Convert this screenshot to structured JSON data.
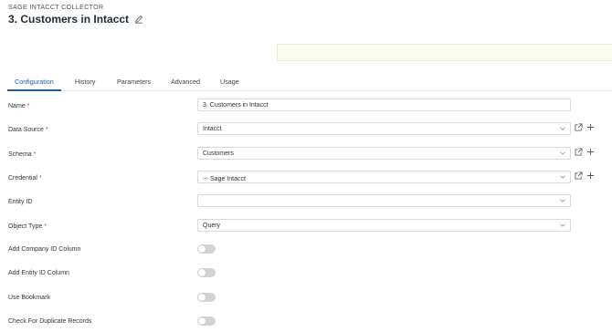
{
  "header": {
    "eyebrow": "SAGE INTACCT COLLECTOR",
    "title": "3. Customers in Intacct"
  },
  "tabs": [
    {
      "label": "Configuration",
      "active": true
    },
    {
      "label": "History",
      "active": false
    },
    {
      "label": "Parameters",
      "active": false
    },
    {
      "label": "Advanced",
      "active": false
    },
    {
      "label": "Usage",
      "active": false
    }
  ],
  "form": {
    "name": {
      "label": "Name",
      "required": true,
      "value": "3. Customers in Intacct"
    },
    "data_source": {
      "label": "Data Source",
      "required": true,
      "value": "Intacct"
    },
    "schema": {
      "label": "Schema",
      "required": true,
      "value": "Customers"
    },
    "credential": {
      "label": "Credential",
      "required": true,
      "icon": "sage-logo-icon",
      "value": "Sage Intacct"
    },
    "entity_id": {
      "label": "Entity ID",
      "required": false,
      "value": ""
    },
    "object_type": {
      "label": "Object Type",
      "required": true,
      "value": "Query"
    },
    "add_company_id": {
      "label": "Add Company ID Column",
      "on": false
    },
    "add_entity_id": {
      "label": "Add Entity ID Column",
      "on": false
    },
    "use_bookmark": {
      "label": "Use Bookmark",
      "on": false
    },
    "check_duplicates": {
      "label": "Check For Duplicate Records",
      "on": false
    }
  },
  "colors": {
    "accent": "#1c5fa8",
    "required": "#d23b3b",
    "notice_bg": "#fbfdef",
    "toggle_off": "#d0d4d9"
  },
  "required_marker": "*"
}
